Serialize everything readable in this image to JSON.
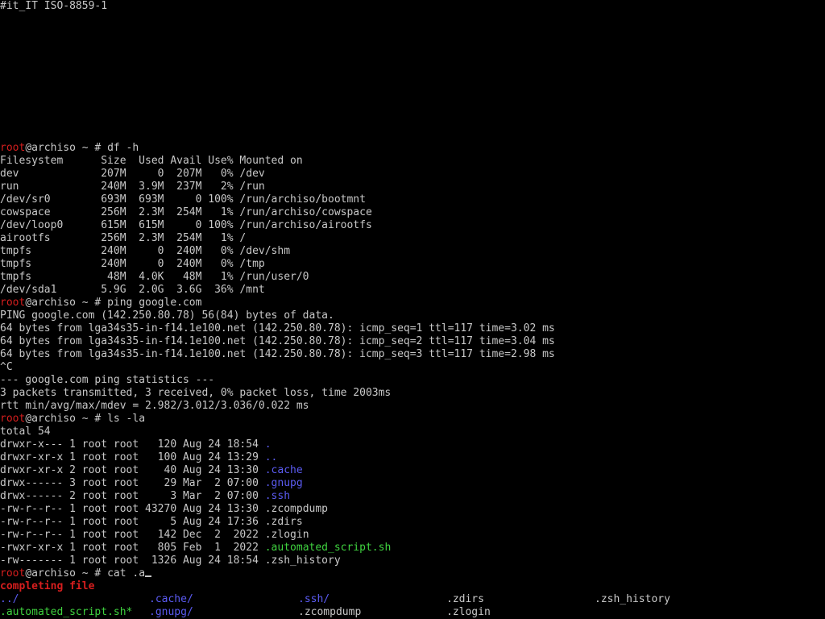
{
  "colors": {
    "background": "#000000",
    "text": "#c8c8c8",
    "prompt_user": "#d61e1e",
    "directory": "#5b5bf2",
    "executable": "#3fd23f",
    "completing_label": "#d61e1e"
  },
  "header": {
    "locale_line": "#it_IT ISO-8859-1"
  },
  "prompt": {
    "user": "root",
    "rest": "@archiso ~ # "
  },
  "commands": {
    "df": "df -h",
    "ping": "ping google.com",
    "ls": "ls -la",
    "current": "cat .a"
  },
  "df_output": [
    "Filesystem      Size  Used Avail Use% Mounted on",
    "dev             207M     0  207M   0% /dev",
    "run             240M  3.9M  237M   2% /run",
    "/dev/sr0        693M  693M     0 100% /run/archiso/bootmnt",
    "cowspace        256M  2.3M  254M   1% /run/archiso/cowspace",
    "/dev/loop0      615M  615M     0 100% /run/archiso/airootfs",
    "airootfs        256M  2.3M  254M   1% /",
    "tmpfs           240M     0  240M   0% /dev/shm",
    "tmpfs           240M     0  240M   0% /tmp",
    "tmpfs            48M  4.0K   48M   1% /run/user/0",
    "/dev/sda1       5.9G  2.0G  3.6G  36% /mnt"
  ],
  "ping_output": [
    "PING google.com (142.250.80.78) 56(84) bytes of data.",
    "64 bytes from lga34s35-in-f14.1e100.net (142.250.80.78): icmp_seq=1 ttl=117 time=3.02 ms",
    "64 bytes from lga34s35-in-f14.1e100.net (142.250.80.78): icmp_seq=2 ttl=117 time=3.04 ms",
    "64 bytes from lga34s35-in-f14.1e100.net (142.250.80.78): icmp_seq=3 ttl=117 time=2.98 ms",
    "^C",
    "--- google.com ping statistics ---",
    "3 packets transmitted, 3 received, 0% packet loss, time 2003ms",
    "rtt min/avg/max/mdev = 2.982/3.012/3.036/0.022 ms"
  ],
  "ls_total": "total 54",
  "ls_entries": [
    {
      "meta": "drwxr-x--- 1 root root   120 Aug 24 18:54 ",
      "name": ".",
      "kind": "dir"
    },
    {
      "meta": "drwxr-xr-x 1 root root   100 Aug 24 13:29 ",
      "name": "..",
      "kind": "dir"
    },
    {
      "meta": "drwxr-xr-x 2 root root    40 Aug 24 13:30 ",
      "name": ".cache",
      "kind": "dir"
    },
    {
      "meta": "drwx------ 3 root root    29 Mar  2 07:00 ",
      "name": ".gnupg",
      "kind": "dir"
    },
    {
      "meta": "drwx------ 2 root root     3 Mar  2 07:00 ",
      "name": ".ssh",
      "kind": "dir"
    },
    {
      "meta": "-rw-r--r-- 1 root root 43270 Aug 24 13:30 ",
      "name": ".zcompdump",
      "kind": "file"
    },
    {
      "meta": "-rw-r--r-- 1 root root     5 Aug 24 17:36 ",
      "name": ".zdirs",
      "kind": "file"
    },
    {
      "meta": "-rw-r--r-- 1 root root   142 Dec  2  2022 ",
      "name": ".zlogin",
      "kind": "file"
    },
    {
      "meta": "-rwxr-xr-x 1 root root   805 Feb  1  2022 ",
      "name": ".automated_script.sh",
      "kind": "exe"
    },
    {
      "meta": "-rw------- 1 root root  1326 Aug 24 18:54 ",
      "name": ".zsh_history",
      "kind": "file"
    }
  ],
  "completion": {
    "label_a": "completing",
    "label_b": "file",
    "rows": [
      [
        {
          "name": "../",
          "kind": "dir"
        },
        {
          "name": ".cache/",
          "kind": "dir"
        },
        {
          "name": ".ssh/",
          "kind": "dir"
        },
        {
          "name": ".zdirs",
          "kind": "file"
        },
        {
          "name": ".zsh_history",
          "kind": "file"
        }
      ],
      [
        {
          "name": ".automated_script.sh*",
          "kind": "exe"
        },
        {
          "name": ".gnupg/",
          "kind": "dir"
        },
        {
          "name": ".zcompdump",
          "kind": "file"
        },
        {
          "name": ".zlogin",
          "kind": "file"
        }
      ]
    ]
  }
}
